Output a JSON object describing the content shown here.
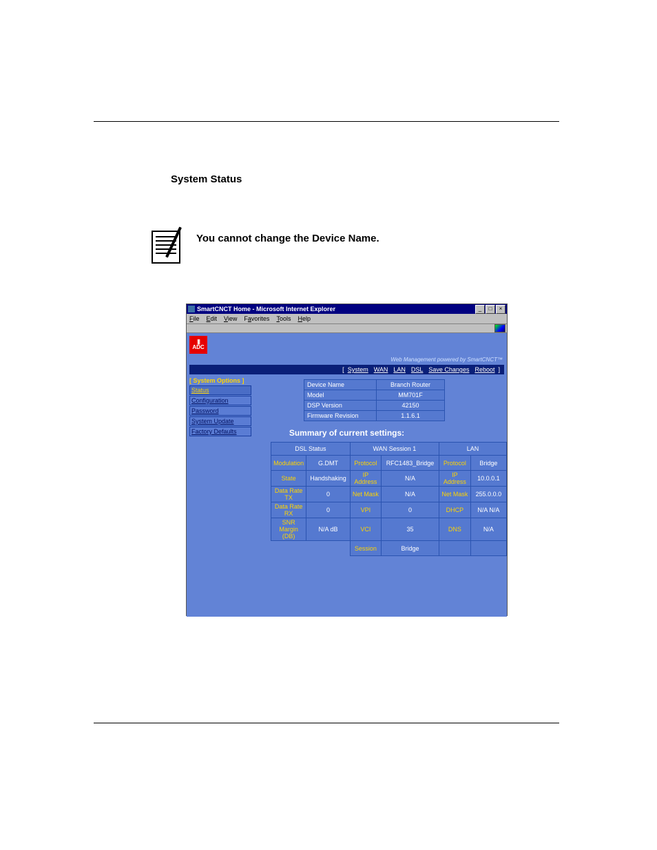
{
  "heading": "System Status",
  "note_text": "You cannot change the Device Name.",
  "window": {
    "title": "SmartCNCT Home - Microsoft Internet Explorer",
    "title_btns": {
      "min": "_",
      "max": "□",
      "close": "×"
    },
    "menu": {
      "file": "File",
      "edit": "Edit",
      "view": "View",
      "favorites": "Favorites",
      "tools": "Tools",
      "help": "Help"
    },
    "powered_by": "Web Management powered by SmartCNCT™"
  },
  "adc_logo_text": "ADC",
  "navbar": {
    "lb": "[",
    "rb": "]",
    "items": [
      "System",
      "WAN",
      "LAN",
      "DSL",
      "Save Changes",
      "Reboot"
    ]
  },
  "sidebar": {
    "title": "[ System Options ]",
    "items": [
      {
        "label": "Status",
        "active": true
      },
      {
        "label": "Configuration",
        "active": false
      },
      {
        "label": "Password",
        "active": false
      },
      {
        "label": "System Update",
        "active": false
      },
      {
        "label": "Factory Defaults",
        "active": false
      }
    ]
  },
  "info": [
    {
      "label": "Device Name",
      "value": "Branch Router"
    },
    {
      "label": "Model",
      "value": "MM701F"
    },
    {
      "label": "DSP Version",
      "value": "42150"
    },
    {
      "label": "Firmware Revision",
      "value": "1.1.6.1"
    }
  ],
  "summary_title": "Summary of current settings:",
  "headers": {
    "dsl": "DSL Status",
    "wan": "WAN Session 1",
    "lan": "LAN"
  },
  "rows": {
    "r1": {
      "dslL": "Modulation",
      "dslV": "G.DMT",
      "wanL": "Protocol",
      "wanV": "RFC1483_Bridge",
      "lanL": "Protocol",
      "lanV": "Bridge"
    },
    "r2": {
      "dslL": "State",
      "dslV": "Handshaking",
      "wanL": "IP Address",
      "wanV": "N/A",
      "lanL": "IP Address",
      "lanV": "10.0.0.1"
    },
    "r3": {
      "dslL": "Data Rate TX",
      "dslV": "0",
      "wanL": "Net Mask",
      "wanV": "N/A",
      "lanL": "Net Mask",
      "lanV": "255.0.0.0"
    },
    "r4": {
      "dslL": "Data Rate RX",
      "dslV": "0",
      "wanL": "VPI",
      "wanV": "0",
      "lanL": "DHCP",
      "lanV": "N/A N/A"
    },
    "r5": {
      "dslL": "SNR Margin (DB)",
      "dslV": "N/A dB",
      "wanL": "VCI",
      "wanV": "35",
      "lanL": "DNS",
      "lanV": "N/A"
    },
    "r6": {
      "wanL": "Session",
      "wanV": "Bridge"
    }
  }
}
